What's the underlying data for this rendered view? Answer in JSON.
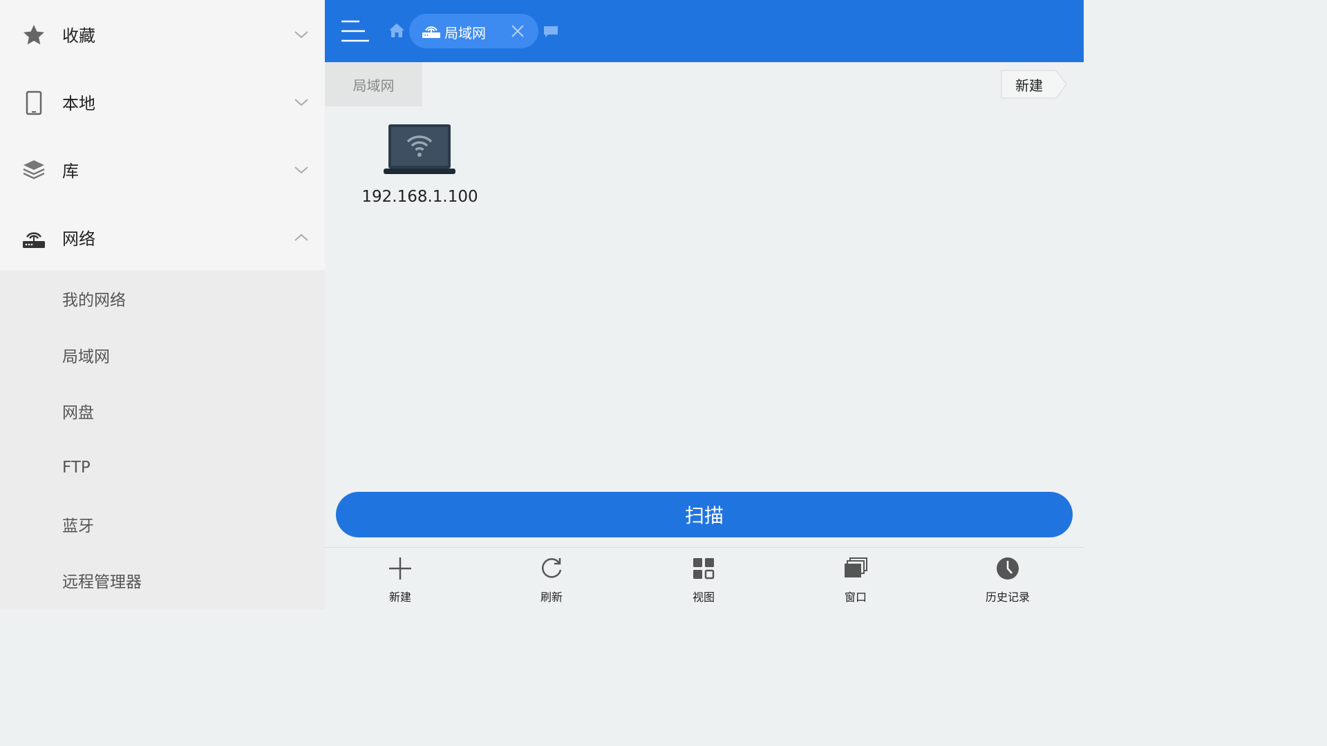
{
  "sidebar": {
    "groups": [
      {
        "label": "收藏",
        "icon": "star-icon",
        "expanded": false
      },
      {
        "label": "本地",
        "icon": "phone-icon",
        "expanded": false
      },
      {
        "label": "库",
        "icon": "layers-icon",
        "expanded": false
      },
      {
        "label": "网络",
        "icon": "router-icon",
        "expanded": true
      }
    ],
    "network_items": [
      {
        "label": "我的网络"
      },
      {
        "label": "局域网"
      },
      {
        "label": "网盘"
      },
      {
        "label": "FTP"
      },
      {
        "label": "蓝牙"
      },
      {
        "label": "远程管理器"
      }
    ]
  },
  "topbar": {
    "active_tab": {
      "label": "局域网",
      "icon": "router-icon"
    }
  },
  "pathbar": {
    "crumb": "局域网",
    "new_label": "新建"
  },
  "devices": [
    {
      "label": "192.168.1.100",
      "icon": "laptop-wifi-icon"
    }
  ],
  "scan_label": "扫描",
  "toolbar": {
    "items": [
      {
        "label": "新建",
        "icon": "plus-icon"
      },
      {
        "label": "刷新",
        "icon": "refresh-icon"
      },
      {
        "label": "视图",
        "icon": "grid-view-icon"
      },
      {
        "label": "窗口",
        "icon": "windows-icon"
      },
      {
        "label": "历史记录",
        "icon": "clock-icon"
      }
    ]
  },
  "colors": {
    "accent": "#2074e0",
    "tab_bg": "#3d8af0",
    "sidebar_bg": "#f5f5f5",
    "submenu_bg": "#ececec",
    "content_bg": "#eef1f1"
  }
}
